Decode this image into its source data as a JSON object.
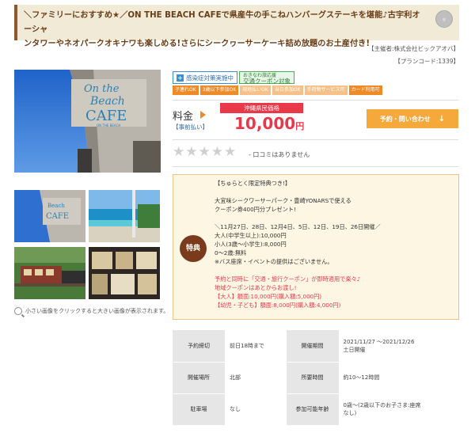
{
  "banner": {
    "line1": "＼ファミリーにおすすめ★／ON THE BEACH CAFEで県産牛の手こねハンバーグステーキを堪能♪古宇利オーシャ",
    "line2": "ンタワーやネオパークオキナワも楽しめる!さらにシークヮーサーケーキ詰め放題のお土産付き!"
  },
  "organizer": "【主催者:株式会社ビックアオバ】",
  "plan_code": "【プランコード:1339】",
  "gallery_hint": "小さい画像をクリックすると大きい画像が表示されます。",
  "tags": {
    "covid": "感染症対策実施中",
    "coupon_small": "おきなわ旅応援",
    "coupon_big": "交通クーポン対象",
    "features": [
      "子連れOK",
      "3歳以下参加OK",
      "現地払いOK",
      "当日参加OK",
      "手荷物サービス可",
      "カード利用可"
    ]
  },
  "price": {
    "label": "料金",
    "payment": "【事前払い】",
    "resident_label": "沖縄県民価格",
    "amount": "10,000",
    "unit": "円"
  },
  "reserve_button": "予約・問い合わせ",
  "review": {
    "rating": 0,
    "max": 5,
    "text": "- 口コミはありません"
  },
  "special": {
    "badge": "特典",
    "lines": [
      {
        "text": "【ちゅらとく限定特典つき!】",
        "red": false
      },
      {
        "text": "",
        "red": false
      },
      {
        "text": "大宜味シークワーサーパーク・豊崎YONARSで使える",
        "red": false
      },
      {
        "text": "クーポン券400円分プレゼント!",
        "red": false
      },
      {
        "text": "",
        "red": false
      },
      {
        "text": "＼11月27日、28日、12月4日、5日、12日、19日、26日開催／",
        "red": false
      },
      {
        "text": "大人(中学生以上):10,000円",
        "red": false
      },
      {
        "text": "小人(3歳〜小学生):8,000円",
        "red": false
      },
      {
        "text": "0〜2歳:無料",
        "red": false
      },
      {
        "text": "※バス座席・イベントの提供はございません。",
        "red": false
      },
      {
        "text": "",
        "red": false
      },
      {
        "text": "予約と同時に「交通・旅行クーポン」が即時適用で楽々♪",
        "red": true
      },
      {
        "text": "地域クーポンはあとからお渡し!",
        "red": true
      },
      {
        "text": "【大人】額面:10,000円(購入額:5,000円)",
        "red": true
      },
      {
        "text": "【幼児・子ども】額面:8,000円(購入額:4,000円)",
        "red": true
      }
    ]
  },
  "info": [
    {
      "k1": "予約締切",
      "v1": "前日18時まで",
      "k2": "開催期間",
      "v2a": "2021/11/27 〜2021/12/26",
      "v2b": "土日開催"
    },
    {
      "k1": "開催場所",
      "v1": "北部",
      "k2": "所要時間",
      "v2a": "約10〜12時間",
      "v2b": ""
    },
    {
      "k1": "駐車場",
      "v1": "なし",
      "k2": "参加可能年齢",
      "v2a": "0歳〜(2歳以下のお子さま:座席",
      "v2b": "なし)"
    }
  ],
  "photo": {
    "sign_line1": "On the",
    "sign_line2": "Beach",
    "sign_line3": "CAFE",
    "sign_sub": "ON THE BEACH"
  }
}
